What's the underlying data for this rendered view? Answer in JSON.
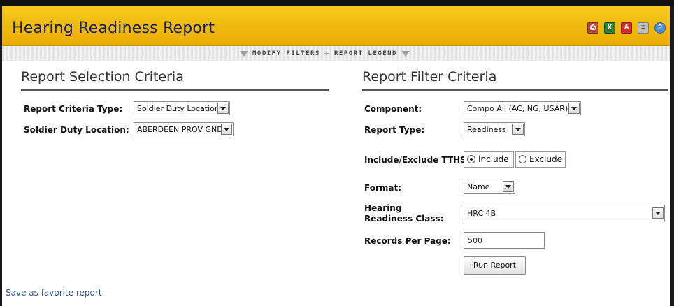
{
  "header": {
    "title": "Hearing Readiness Report",
    "tools": [
      {
        "icon": "print-icon",
        "color": "#b84a3a"
      },
      {
        "icon": "excel-icon",
        "color": "#2e7d32"
      },
      {
        "icon": "pdf-icon",
        "color": "#d32f2f"
      },
      {
        "icon": "document-icon",
        "color": "#8a8a8a"
      },
      {
        "icon": "help-icon",
        "color": "#4f8fd6"
      }
    ]
  },
  "filterbar": {
    "modify_filters": "MODIFY FILTERS",
    "separator": "+",
    "report_legend": "REPORT LEGEND"
  },
  "selection": {
    "title": "Report Selection Criteria",
    "criteria_type_label": "Report Criteria Type:",
    "criteria_type_value": "Soldier Duty Location",
    "duty_location_label": "Soldier Duty Location:",
    "duty_location_value": "ABERDEEN PROV GND"
  },
  "filters": {
    "title": "Report Filter Criteria",
    "component_label": "Component:",
    "component_value": "Compo All (AC, NG, USAR)",
    "report_type_label": "Report Type:",
    "report_type_value": "Readiness",
    "tths_label": "Include/Exclude TTHS:",
    "tths_include": "Include",
    "tths_exclude": "Exclude",
    "format_label": "Format:",
    "format_value": "Name",
    "hrc_label": "Hearing Readiness Class:",
    "hrc_value": "HRC 4B",
    "records_label": "Records Per Page:",
    "records_value": "500",
    "run_button": "Run Report"
  },
  "footer": {
    "favorite_link": "Save as favorite report"
  }
}
